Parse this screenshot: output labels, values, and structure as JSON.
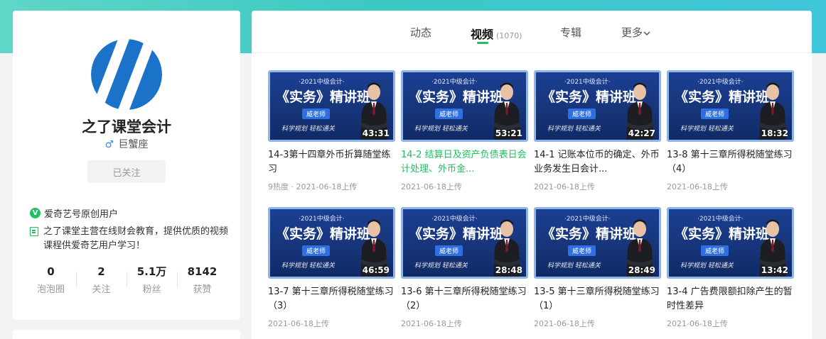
{
  "profile": {
    "name": "之了课堂会计",
    "gender_symbol": "♂",
    "zodiac": "巨蟹座",
    "follow_label": "已关注",
    "verify_label": "爱奇艺号原创用户",
    "description": "之了课堂主营在线财会教育，提供优质的视频课程供爱奇艺用户学习！",
    "stats": [
      {
        "value": "0",
        "label": "泡泡圈"
      },
      {
        "value": "2",
        "label": "关注"
      },
      {
        "value": "5.1万",
        "label": "粉丝"
      },
      {
        "value": "8142",
        "label": "获赞"
      }
    ],
    "colors": {
      "accent": "#1ec15f",
      "logo": "#1a73c8"
    }
  },
  "tabs": {
    "dynamic": "动态",
    "video": "视频",
    "video_count": "(1070)",
    "album": "专辑",
    "more": "更多"
  },
  "thumbnail": {
    "year": "·2021中级会计·",
    "title": "《实务》精讲班",
    "teacher": "威老师",
    "slogan": "科学规划  轻松通关"
  },
  "videos": [
    {
      "duration": "43:31",
      "title": "14-3第十四章外币折算随堂练习",
      "meta": "9热度 · 2021-06-18上传",
      "highlight": false
    },
    {
      "duration": "53:21",
      "title": "14-2 结算日及资产负债表日会计处理、外币金...",
      "meta": "2021-06-18上传",
      "highlight": true
    },
    {
      "duration": "42:27",
      "title": "14-1 记账本位币的确定、外币业务发生日会计...",
      "meta": "2021-06-18上传",
      "highlight": false
    },
    {
      "duration": "18:32",
      "title": "13-8 第十三章所得税随堂练习（4）",
      "meta": "2021-06-18上传",
      "highlight": false
    },
    {
      "duration": "46:59",
      "title": "13-7 第十三章所得税随堂练习（3）",
      "meta": "2021-06-18上传",
      "highlight": false
    },
    {
      "duration": "28:48",
      "title": "13-6 第十三章所得税随堂练习（2）",
      "meta": "2021-06-18上传",
      "highlight": false
    },
    {
      "duration": "28:49",
      "title": "13-5 第十三章所得税随堂练习（1）",
      "meta": "2021-06-18上传",
      "highlight": false
    },
    {
      "duration": "13:42",
      "title": "13-4 广告费限额扣除产生的暂时性差异",
      "meta": "2021-06-18上传",
      "highlight": false
    }
  ]
}
